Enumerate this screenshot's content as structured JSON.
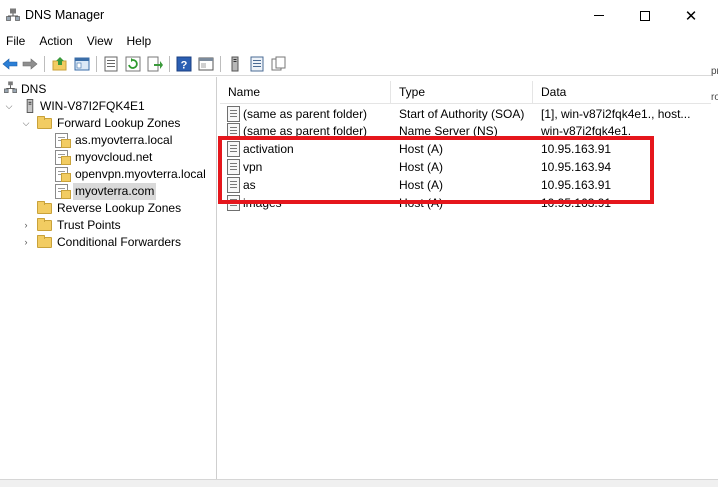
{
  "window": {
    "title": "DNS Manager",
    "minimize_glyph": "",
    "close_glyph": "✕"
  },
  "menu": [
    "File",
    "Action",
    "View",
    "Help"
  ],
  "toolbar": {
    "icons": [
      "back-arrow-icon",
      "forward-arrow-icon",
      "up-folder-icon",
      "show-hide-tree-icon",
      "properties-icon",
      "refresh-icon",
      "export-list-icon",
      "help-icon",
      "console-window-icon",
      "server-icon",
      "record-list-icon",
      "copy-icon"
    ]
  },
  "tree": {
    "root": "DNS",
    "server": "WIN-V87I2FQK4E1",
    "forward_zones": "Forward Lookup Zones",
    "zones": [
      "as.myovterra.local",
      "myovcloud.net",
      "openvpn.myovterra.local",
      "myovterra.com"
    ],
    "reverse_zones": "Reverse Lookup Zones",
    "trust_points": "Trust Points",
    "conditional_forwarders": "Conditional Forwarders"
  },
  "records": {
    "columns": [
      "Name",
      "Type",
      "Data"
    ],
    "rows": [
      {
        "name": "(same as parent folder)",
        "type": "Start of Authority (SOA)",
        "data": "[1], win-v87i2fqk4e1., host..."
      },
      {
        "name": "(same as parent folder)",
        "type": "Name Server (NS)",
        "data": "win-v87i2fqk4e1."
      },
      {
        "name": "activation",
        "type": "Host (A)",
        "data": "10.95.163.91"
      },
      {
        "name": "vpn",
        "type": "Host (A)",
        "data": "10.95.163.94"
      },
      {
        "name": "as",
        "type": "Host (A)",
        "data": "10.95.163.91"
      },
      {
        "name": "images",
        "type": "Host (A)",
        "data": "10.95.163.91"
      }
    ]
  },
  "edge_fragments": [
    "pr",
    "ro"
  ],
  "colors": {
    "highlight": "#e5161c",
    "selection": "#d9d9d9",
    "folder": "#f2cc62"
  }
}
